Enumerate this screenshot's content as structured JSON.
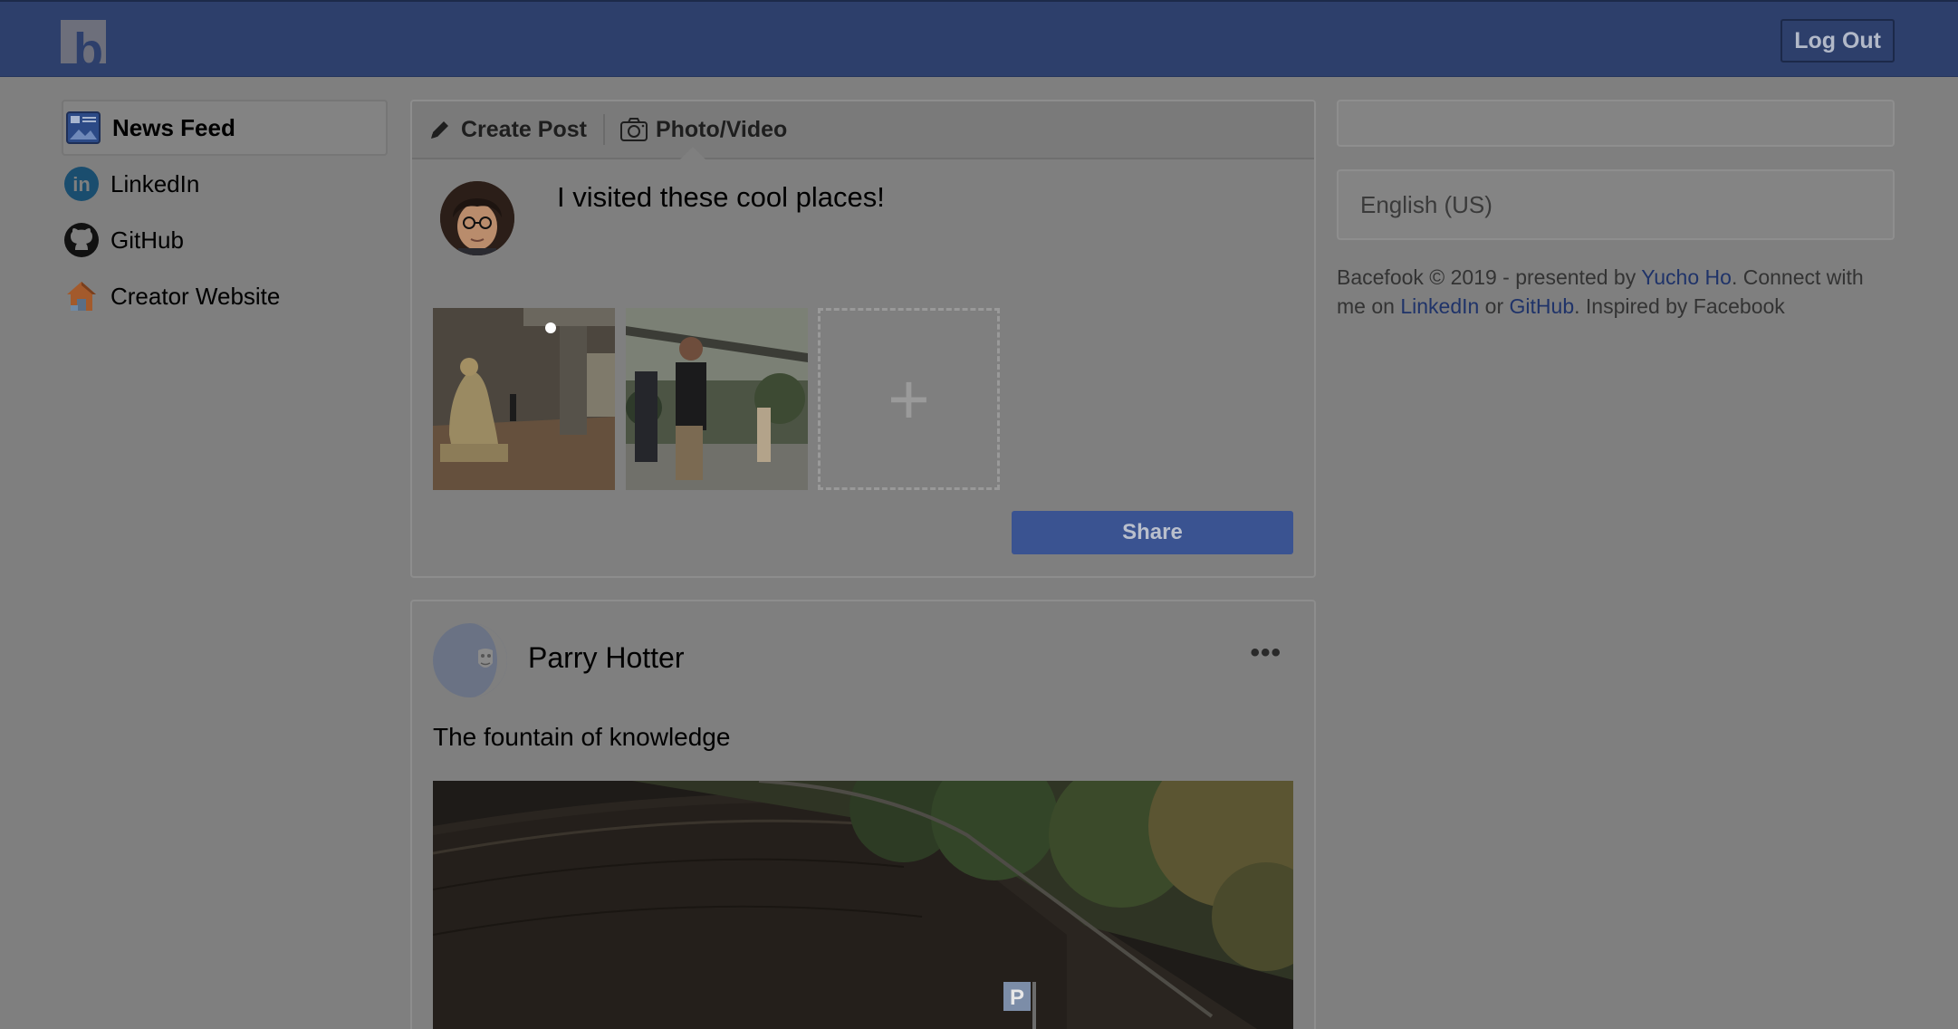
{
  "header": {
    "logo_letter": "b",
    "logout_label": "Log Out"
  },
  "sidebar": {
    "items": [
      {
        "label": "News Feed",
        "icon": "news-feed-icon",
        "active": true
      },
      {
        "label": "LinkedIn",
        "icon": "linkedin-icon",
        "active": false
      },
      {
        "label": "GitHub",
        "icon": "github-icon",
        "active": false
      },
      {
        "label": "Creator Website",
        "icon": "house-icon",
        "active": false
      }
    ]
  },
  "composer": {
    "tabs": [
      {
        "label": "Create Post",
        "icon": "pencil-icon"
      },
      {
        "label": "Photo/Video",
        "icon": "camera-icon"
      }
    ],
    "post_text": "I visited these cool places!",
    "add_photo_symbol": "+",
    "share_label": "Share"
  },
  "feed": {
    "posts": [
      {
        "author": "Parry Hotter",
        "menu_symbol": "•••",
        "caption": "The fountain of knowledge"
      }
    ]
  },
  "right": {
    "language": "English (US)",
    "footer": {
      "prefix": "Bacefook © 2019 - presented by ",
      "author_link": "Yucho Ho",
      "middle": ". Connect with me on ",
      "linkedin_link": "LinkedIn",
      "or": " or ",
      "github_link": "GitHub",
      "suffix": ". Inspired by Facebook"
    }
  },
  "colors": {
    "topbar": "#2d3f6b",
    "overlay_background": "#7f7f7f",
    "share_button": "#3a5391",
    "link": "#1f3369"
  }
}
